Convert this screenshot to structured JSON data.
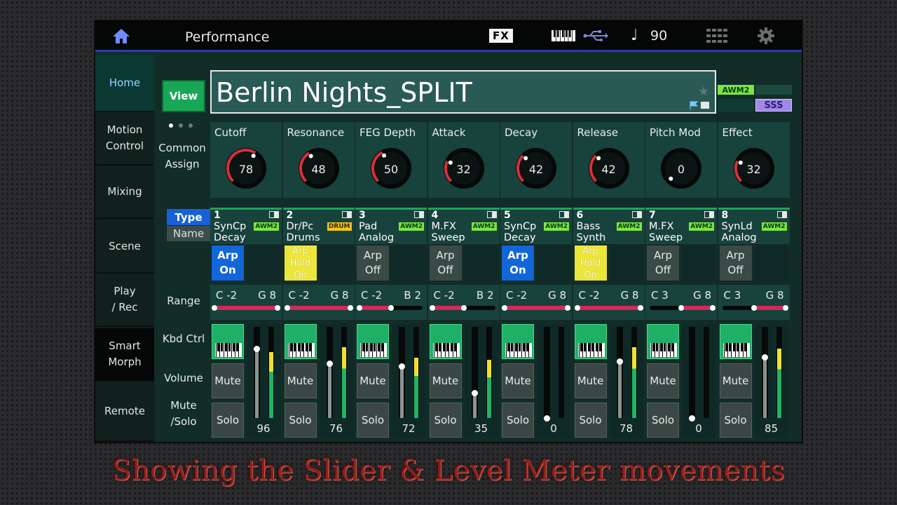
{
  "topbar": {
    "title": "Performance",
    "fx_label": "FX",
    "tempo": "90",
    "icons": [
      "home-icon",
      "keyboard-icon",
      "usb-icon",
      "note-icon",
      "grid-icon",
      "gear-icon"
    ]
  },
  "sidebar": {
    "items": [
      {
        "label": "Home"
      },
      {
        "label": "Motion\nControl"
      },
      {
        "label": "Mixing"
      },
      {
        "label": "Scene"
      },
      {
        "label": "Play\n/ Rec"
      },
      {
        "label": "Smart\nMorph"
      },
      {
        "label": "Remote"
      }
    ]
  },
  "view_label": "View",
  "performance_name": "Berlin Nights_SPLIT",
  "badges": {
    "awm": "AWM2",
    "sss": "SSS"
  },
  "common_assign_label": "Common\nAssign",
  "knobs": [
    {
      "label": "Cutoff",
      "value": "78",
      "v": 78
    },
    {
      "label": "Resonance",
      "value": "48",
      "v": 48
    },
    {
      "label": "FEG Depth",
      "value": "50",
      "v": 50
    },
    {
      "label": "Attack",
      "value": "32",
      "v": 32
    },
    {
      "label": "Decay",
      "value": "42",
      "v": 42
    },
    {
      "label": "Release",
      "value": "42",
      "v": 42
    },
    {
      "label": "Pitch Mod",
      "value": "0",
      "v": 0
    },
    {
      "label": "Effect",
      "value": "32",
      "v": 32
    }
  ],
  "type_label": "Type",
  "name_label": "Name",
  "row_labels": {
    "range": "Range",
    "kbd_ctrl": "Kbd Ctrl",
    "volume": "Volume",
    "mute_solo": "Mute\n/Solo"
  },
  "mute_label": "Mute",
  "solo_label": "Solo",
  "parts": [
    {
      "num": "1",
      "name": "SynCp\nDecay",
      "badge": "AWM2",
      "badge_type": "awm",
      "arp": "Arp\nOn",
      "arp_state": "on",
      "range_lo": "C -2",
      "range_hi": "G 8",
      "rlo": 0.0,
      "rhi": 1.0,
      "volume": "96",
      "vol": 0.76,
      "meter": 0.72
    },
    {
      "num": "2",
      "name": "Dr/Pc\nDrums",
      "badge": "DRUM",
      "badge_type": "drum",
      "arp": "Arp\nHold\nOn",
      "arp_state": "hold",
      "range_lo": "C -2",
      "range_hi": "G 8",
      "rlo": 0.0,
      "rhi": 1.0,
      "volume": "76",
      "vol": 0.6,
      "meter": 0.78
    },
    {
      "num": "3",
      "name": "Pad\nAnalog",
      "badge": "AWM2",
      "badge_type": "awm",
      "arp": "Arp\nOff",
      "arp_state": "off",
      "range_lo": "C -2",
      "range_hi": "B 2",
      "rlo": 0.0,
      "rhi": 0.5,
      "volume": "72",
      "vol": 0.57,
      "meter": 0.66
    },
    {
      "num": "4",
      "name": "M.FX\nSweep",
      "badge": "AWM2",
      "badge_type": "awm",
      "arp": "Arp\nOff",
      "arp_state": "off",
      "range_lo": "C -2",
      "range_hi": "B 2",
      "rlo": 0.0,
      "rhi": 0.5,
      "volume": "35",
      "vol": 0.28,
      "meter": 0.64
    },
    {
      "num": "5",
      "name": "SynCp\nDecay",
      "badge": "AWM2",
      "badge_type": "awm",
      "arp": "Arp\nOn",
      "arp_state": "on",
      "range_lo": "C -2",
      "range_hi": "G 8",
      "rlo": 0.0,
      "rhi": 1.0,
      "volume": "0",
      "vol": 0.0,
      "meter": 0.0
    },
    {
      "num": "6",
      "name": "Bass\nSynth",
      "badge": "AWM2",
      "badge_type": "awm",
      "arp": "Arp\nHold\nOn",
      "arp_state": "hold",
      "range_lo": "C -2",
      "range_hi": "G 8",
      "rlo": 0.0,
      "rhi": 1.0,
      "volume": "78",
      "vol": 0.62,
      "meter": 0.78
    },
    {
      "num": "7",
      "name": "M.FX\nSweep",
      "badge": "AWM2",
      "badge_type": "awm",
      "arp": "Arp\nOff",
      "arp_state": "off",
      "range_lo": "C 3",
      "range_hi": "G 8",
      "rlo": 0.5,
      "rhi": 1.0,
      "volume": "0",
      "vol": 0.0,
      "meter": 0.0
    },
    {
      "num": "8",
      "name": "SynLd\nAnalog",
      "badge": "AWM2",
      "badge_type": "awm",
      "arp": "Arp\nOff",
      "arp_state": "off",
      "range_lo": "C 3",
      "range_hi": "G 8",
      "rlo": 0.5,
      "rhi": 1.0,
      "volume": "85",
      "vol": 0.67,
      "meter": 0.76
    }
  ],
  "colors": {
    "accent": "#1da35a",
    "arp_on": "#1266d8",
    "arp_hold": "#ede63a",
    "range_fill": "#d8275a",
    "knob_arc": "#d8303a"
  },
  "caption": "Showing the Slider & Level Meter movements"
}
